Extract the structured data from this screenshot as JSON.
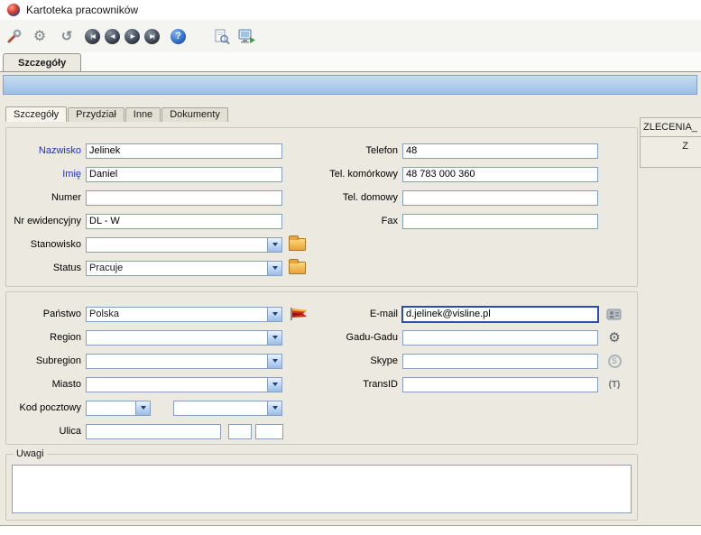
{
  "window": {
    "title": "Kartoteka pracowników"
  },
  "toolbar": {
    "items": [
      {
        "name": "tools-icon",
        "glyph": ""
      },
      {
        "name": "settings-icon",
        "glyph": "⚙"
      },
      {
        "name": "undo-icon",
        "glyph": "↺"
      },
      {
        "name": "first-record-icon",
        "glyph": "|◀"
      },
      {
        "name": "previous-record-icon",
        "glyph": "◀"
      },
      {
        "name": "next-record-icon",
        "glyph": "▶"
      },
      {
        "name": "last-record-icon",
        "glyph": "▶|"
      },
      {
        "name": "help-icon",
        "glyph": "?"
      },
      {
        "name": "search-document-icon",
        "glyph": ""
      },
      {
        "name": "computer-icon",
        "glyph": ""
      }
    ]
  },
  "main_tab": {
    "label": "Szczegóły"
  },
  "subtabs": {
    "items": [
      {
        "label": "Szczegóły"
      },
      {
        "label": "Przydział"
      },
      {
        "label": "Inne"
      },
      {
        "label": "Dokumenty"
      }
    ]
  },
  "side_panel": {
    "header": "ZLECENIA_",
    "value": "Z"
  },
  "personal": {
    "nazwisko_label": "Nazwisko",
    "nazwisko_value": "Jelinek",
    "imie_label": "Imię",
    "imie_value": "Daniel",
    "numer_label": "Numer",
    "numer_value": "",
    "nr_ewidencyjny_label": "Nr ewidencyjny",
    "nr_ewidencyjny_value": "DL - W",
    "stanowisko_label": "Stanowisko",
    "stanowisko_value": "",
    "status_label": "Status",
    "status_value": "Pracuje",
    "telefon_label": "Telefon",
    "telefon_value": "48",
    "tel_komorkowy_label": "Tel. komórkowy",
    "tel_komorkowy_value": "48 783 000 360",
    "tel_domowy_label": "Tel. domowy",
    "tel_domowy_value": "",
    "fax_label": "Fax",
    "fax_value": ""
  },
  "address": {
    "panstwo_label": "Państwo",
    "panstwo_value": "Polska",
    "region_label": "Region",
    "region_value": "",
    "subregion_label": "Subregion",
    "subregion_value": "",
    "miasto_label": "Miasto",
    "miasto_value": "",
    "kod_pocztowy_label": "Kod pocztowy",
    "kod1_value": "",
    "kod2_value": "",
    "ulica_label": "Ulica",
    "ulica_value": "",
    "ulica_nr1_value": "",
    "ulica_nr2_value": "",
    "email_label": "E-mail",
    "email_value": "d.jelinek@visline.pl",
    "gadu_label": "Gadu-Gadu",
    "gadu_value": "",
    "skype_label": "Skype",
    "skype_value": "",
    "transid_label": "TransID",
    "transid_value": ""
  },
  "icons": {
    "skype_glyph": "S",
    "transid_glyph": "(T)"
  },
  "uwagi": {
    "label": "Uwagi",
    "value": ""
  }
}
